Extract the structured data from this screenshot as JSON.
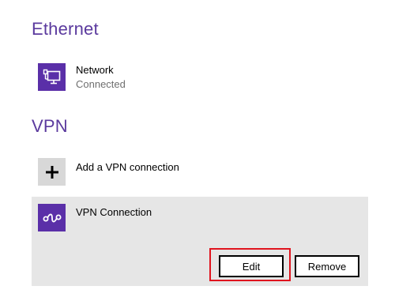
{
  "ethernet": {
    "heading": "Ethernet",
    "items": [
      {
        "title": "Network",
        "status": "Connected",
        "icon": "ethernet-network-icon"
      }
    ]
  },
  "vpn": {
    "heading": "VPN",
    "add_label": "Add a VPN connection",
    "add_icon": "plus-icon",
    "items": [
      {
        "title": "VPN Connection",
        "icon": "vpn-link-icon",
        "selected": true,
        "edit_label": "Edit",
        "remove_label": "Remove"
      }
    ]
  },
  "colors": {
    "accent": "#5b3a9e",
    "tile": "#5a2fa8",
    "selected_bg": "#e6e6e6",
    "highlight": "#e0141e"
  }
}
